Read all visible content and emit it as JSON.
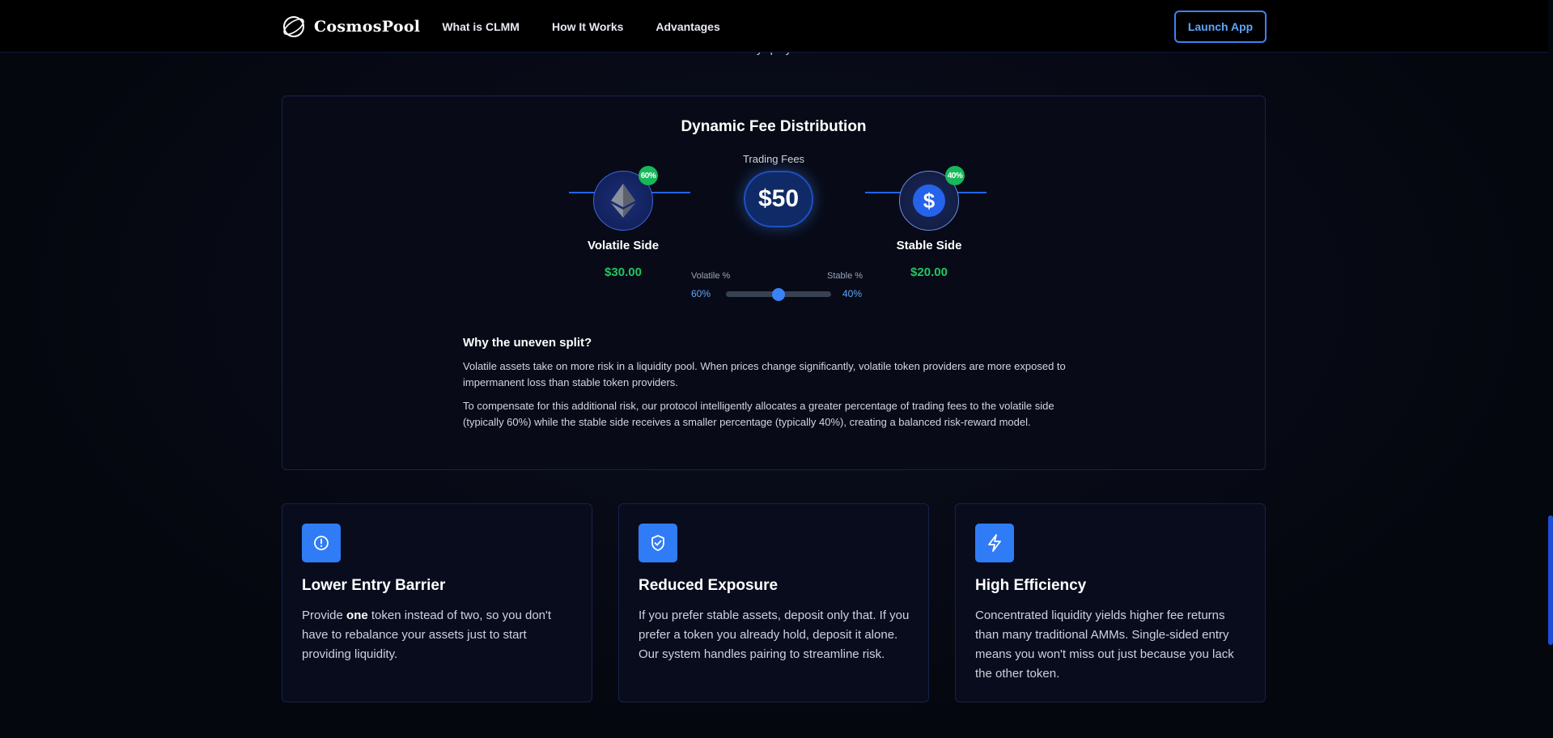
{
  "navbar": {
    "brand": "CosmosPool",
    "links": [
      "What is CLMM",
      "How It Works",
      "Advantages"
    ],
    "launch_label": "Launch App"
  },
  "partial_heading_fragment": "y                    quity",
  "fee_distribution": {
    "title": "Dynamic Fee Distribution",
    "trading_fees_label": "Trading Fees",
    "total_fee": "$50",
    "volatile": {
      "name": "Volatile Side",
      "amount": "$30.00",
      "badge": "60%",
      "icon": "ethereum-icon"
    },
    "stable": {
      "name": "Stable Side",
      "amount": "$20.00",
      "badge": "40%",
      "icon": "dollar-icon"
    },
    "slider": {
      "volatile_label": "Volatile %",
      "stable_label": "Stable %",
      "volatile_value": "60%",
      "stable_value": "40%",
      "position": 0.5
    },
    "why": {
      "title": "Why the uneven split?",
      "p1": "Volatile assets take on more risk in a liquidity pool. When prices change significantly, volatile token providers are more exposed to impermanent loss than stable token providers.",
      "p2": "To compensate for this additional risk, our protocol intelligently allocates a greater percentage of trading fees to the volatile side (typically 60%) while the stable side receives a smaller percentage (typically 40%), creating a balanced risk-reward model."
    }
  },
  "cards": [
    {
      "icon": "alert-circle-icon",
      "title": "Lower Entry Barrier",
      "body_before": "Provide ",
      "body_bold": "one",
      "body_after": " token instead of two, so you don't have to rebalance your assets just to start providing liquidity."
    },
    {
      "icon": "shield-check-icon",
      "title": "Reduced Exposure",
      "body": "If you prefer stable assets, deposit only that. If you prefer a token you already hold, deposit it alone. Our system handles pairing to streamline risk."
    },
    {
      "icon": "lightning-icon",
      "title": "High Efficiency",
      "body": "Concentrated liquidity yields higher fee returns than many traditional AMMs. Single-sided entry means you won't miss out just because you lack the other token."
    }
  ],
  "colors": {
    "accent": "#3b82f6",
    "positive": "#22c55e",
    "badge": "#16b85a",
    "background": "#05070f"
  }
}
